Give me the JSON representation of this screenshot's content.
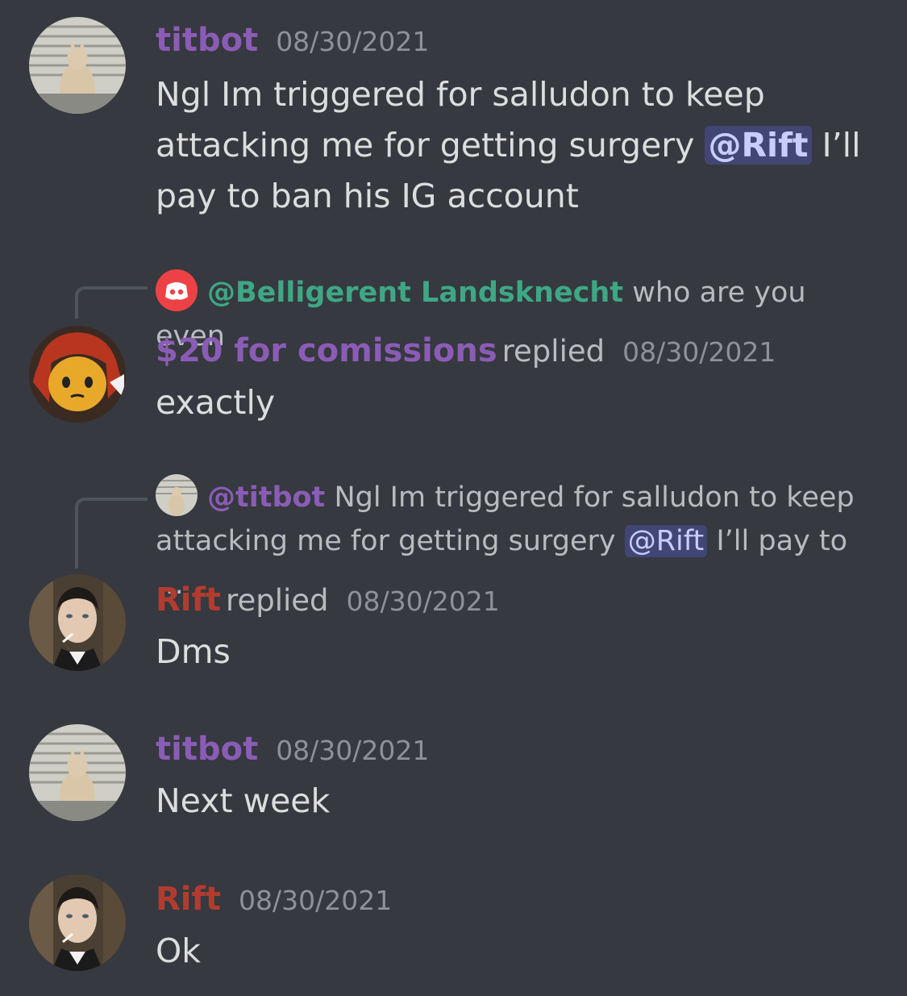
{
  "messages": [
    {
      "author": "titbot",
      "time": "08/30/2021",
      "text_parts": [
        "Ngl Im triggered for salludon to keep attacking me for getting surgery ",
        "@Rift",
        " I’ll pay to ban his IG account"
      ]
    },
    {
      "reply_to": {
        "icon": "discord-logo-icon",
        "author": "@Belligerent Landsknecht",
        "text": "who are you even"
      },
      "author": "$20 for comissions",
      "replied_label": "replied",
      "time": "08/30/2021",
      "text": "exactly"
    },
    {
      "reply_to": {
        "author": "@titbot",
        "text_parts": [
          "Ngl Im triggered for salludon to keep attacking me for getting surgery ",
          "@Rift",
          " I’ll pay to …"
        ]
      },
      "author": "Rift",
      "replied_label": "replied",
      "time": "08/30/2021",
      "text": "Dms"
    },
    {
      "author": "titbot",
      "time": "08/30/2021",
      "text": "Next week"
    },
    {
      "author": "Rift",
      "time": "08/30/2021",
      "text": "Ok"
    }
  ],
  "colors": {
    "background": "#36393f",
    "titbot_name": "#8b5cb6",
    "rift_name": "#b23b30",
    "belligerent_name": "#3ea785",
    "mention_bg": "#414675"
  }
}
